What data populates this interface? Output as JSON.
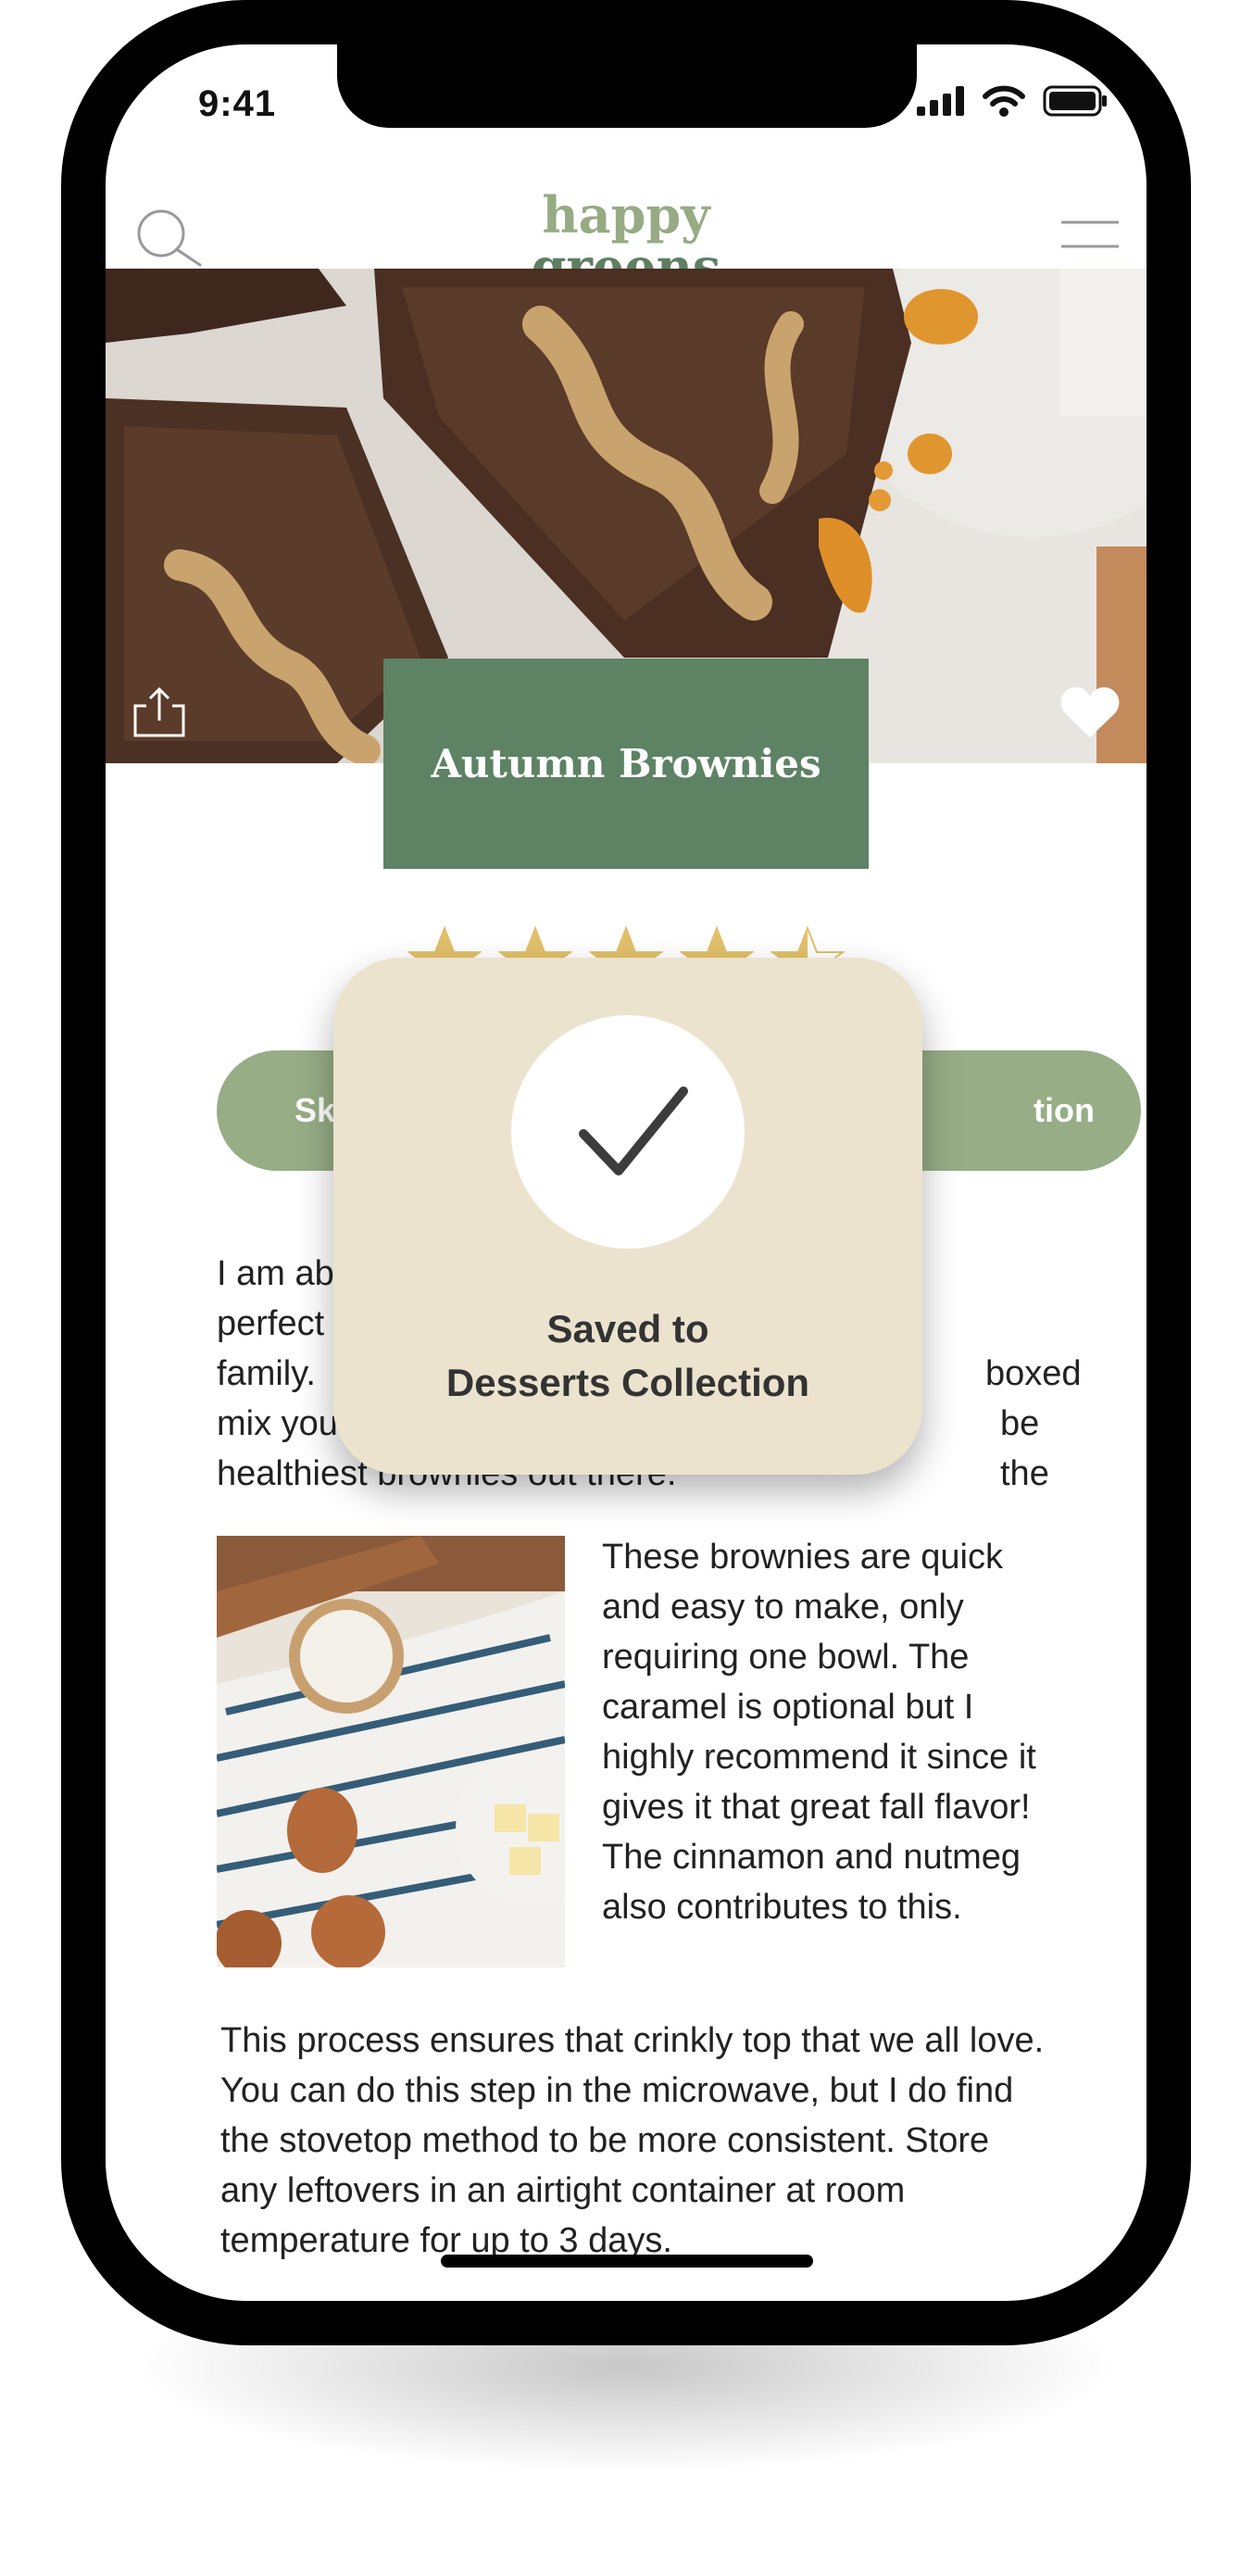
{
  "status_bar": {
    "time": "9:41"
  },
  "header": {
    "logo_line1": "happy",
    "logo_line2": "greens",
    "search_icon": "search-icon",
    "menu_icon": "menu-icon"
  },
  "recipe": {
    "title": "Autumn Brownies",
    "rating": 4.5,
    "rating_max": 5,
    "pill_left_label": "Sk",
    "pill_right_label": "tion",
    "intro_lines": [
      "I am ab",
      "perfect",
      "family.",
      "mix you",
      "healthiest brownies out there."
    ],
    "intro_right_fragments": [
      "boxed",
      "be the"
    ],
    "side_paragraph": "These brownies are quick and easy to make, only requiring one bowl. The caramel is optional but I highly recommend it since it gives it that great fall flavor! The cinnamon and nutmeg also contributes to this.",
    "closing_paragraph": "This process ensures that crinkly top that we all love. You can do this step in the microwave, but I do find the stovetop method to be more consistent. Store any leftovers in an airtight container at room temperature for up to 3 days."
  },
  "toast": {
    "line1": "Saved to",
    "line2": "Desserts Collection"
  },
  "colors": {
    "logo_light": "#96ab84",
    "logo_dark": "#5e7f62",
    "title_bg": "#5e8264",
    "pill": "#96ad86",
    "star": "#e2c06a",
    "toast_bg": "#ece3ce"
  }
}
